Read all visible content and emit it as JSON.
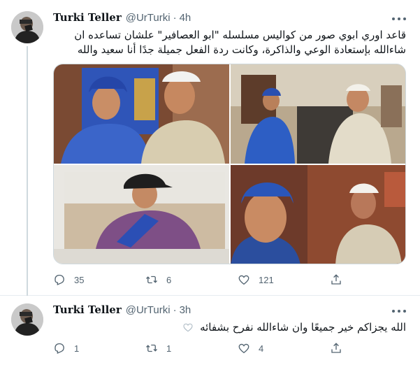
{
  "tweets": [
    {
      "author_name": "Turki Teller",
      "author_handle": "@UrTurki",
      "separator": "·",
      "time": "4h",
      "text": "قاعد اوري ابوي صور من كواليس مسلسله \"ابو العصافير\" علشان تساعده ان شاءالله بإستعادة الوعي والذاكرة، وكانت ردة الفعل جميلة جدًا أنا سعيد والله",
      "media_count": 4,
      "replies": "35",
      "retweets": "6",
      "likes": "121"
    },
    {
      "author_name": "Turki Teller",
      "author_handle": "@UrTurki",
      "separator": "·",
      "time": "3h",
      "text": "الله يجزاكم خير جميعًا وان شاءالله نفرح بشفائه",
      "trailing_emoji": "white-heart",
      "replies": "1",
      "retweets": "1",
      "likes": "4"
    }
  ],
  "icons": {
    "reply": "reply-icon",
    "retweet": "retweet-icon",
    "like": "heart-icon",
    "share": "share-icon",
    "more": "more-icon"
  },
  "colors": {
    "text": "#0f1419",
    "secondary": "#536471",
    "border": "#e6ecf0"
  }
}
